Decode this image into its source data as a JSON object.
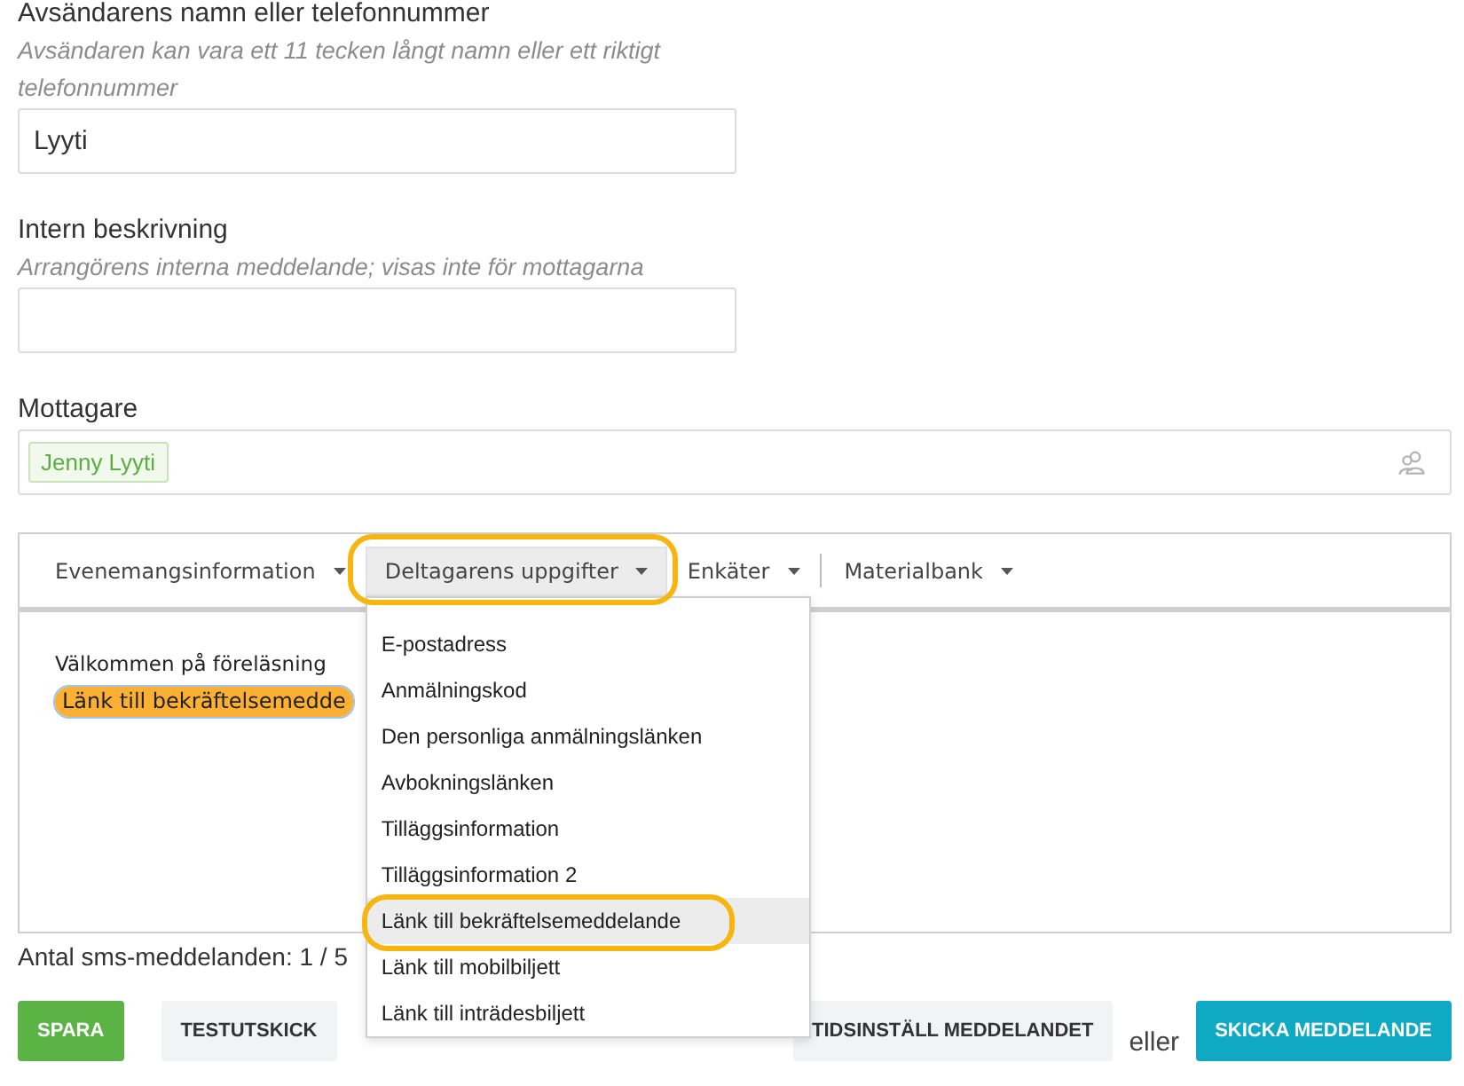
{
  "sender": {
    "label": "Avsändarens namn eller telefonnummer",
    "hint": "Avsändaren kan vara ett 11 tecken långt namn eller ett riktigt telefonnummer",
    "value": "Lyyti"
  },
  "internal_description": {
    "label": "Intern beskrivning",
    "hint": "Arrangörens interna meddelande; visas inte för mottagarna"
  },
  "recipients": {
    "label": "Mottagare",
    "tags": [
      "Jenny Lyyti"
    ]
  },
  "editor": {
    "toolbar": [
      {
        "label": "Evenemangsinformation",
        "open": false,
        "circled": false,
        "separated": false
      },
      {
        "label": "Deltagarens uppgifter",
        "open": true,
        "circled": true,
        "separated": false,
        "menu": {
          "items": [
            {
              "label": "E-postadress",
              "selected": false,
              "circled": false
            },
            {
              "label": "Anmälningskod",
              "selected": false,
              "circled": false
            },
            {
              "label": "Den personliga anmälningslänken",
              "selected": false,
              "circled": false
            },
            {
              "label": "Avbokningslänken",
              "selected": false,
              "circled": false
            },
            {
              "label": "Tilläggsinformation",
              "selected": false,
              "circled": false
            },
            {
              "label": "Tilläggsinformation 2",
              "selected": false,
              "circled": false
            },
            {
              "label": "Länk till bekräftelsemeddelande",
              "selected": true,
              "circled": true
            },
            {
              "label": "Länk till mobilbiljett",
              "selected": false,
              "circled": false
            },
            {
              "label": "Länk till inträdesbiljett",
              "selected": false,
              "circled": false
            }
          ]
        }
      },
      {
        "label": "Enkäter",
        "open": false,
        "circled": false,
        "separated": false
      },
      {
        "label": "Materialbank",
        "open": false,
        "circled": false,
        "separated": true
      }
    ],
    "body": [
      {
        "kind": "text",
        "text": "Välkommen på föreläsning"
      },
      {
        "kind": "field",
        "text": "Länk till bekräftelsemedde",
        "selected": true
      }
    ]
  },
  "sms_count": "Antal sms-meddelanden: 1 / 5",
  "actions": {
    "left": [
      {
        "kind": "primary",
        "label": "SPARA"
      },
      {
        "kind": "secondary",
        "label": "TESTUTSKICK"
      }
    ],
    "right": [
      {
        "kind": "secondary",
        "label": "TIDSINSTÄLL MEDDELANDET"
      },
      {
        "kind": "text",
        "label": "eller"
      },
      {
        "kind": "send",
        "label": "SKICKA MEDDELANDE"
      }
    ]
  }
}
